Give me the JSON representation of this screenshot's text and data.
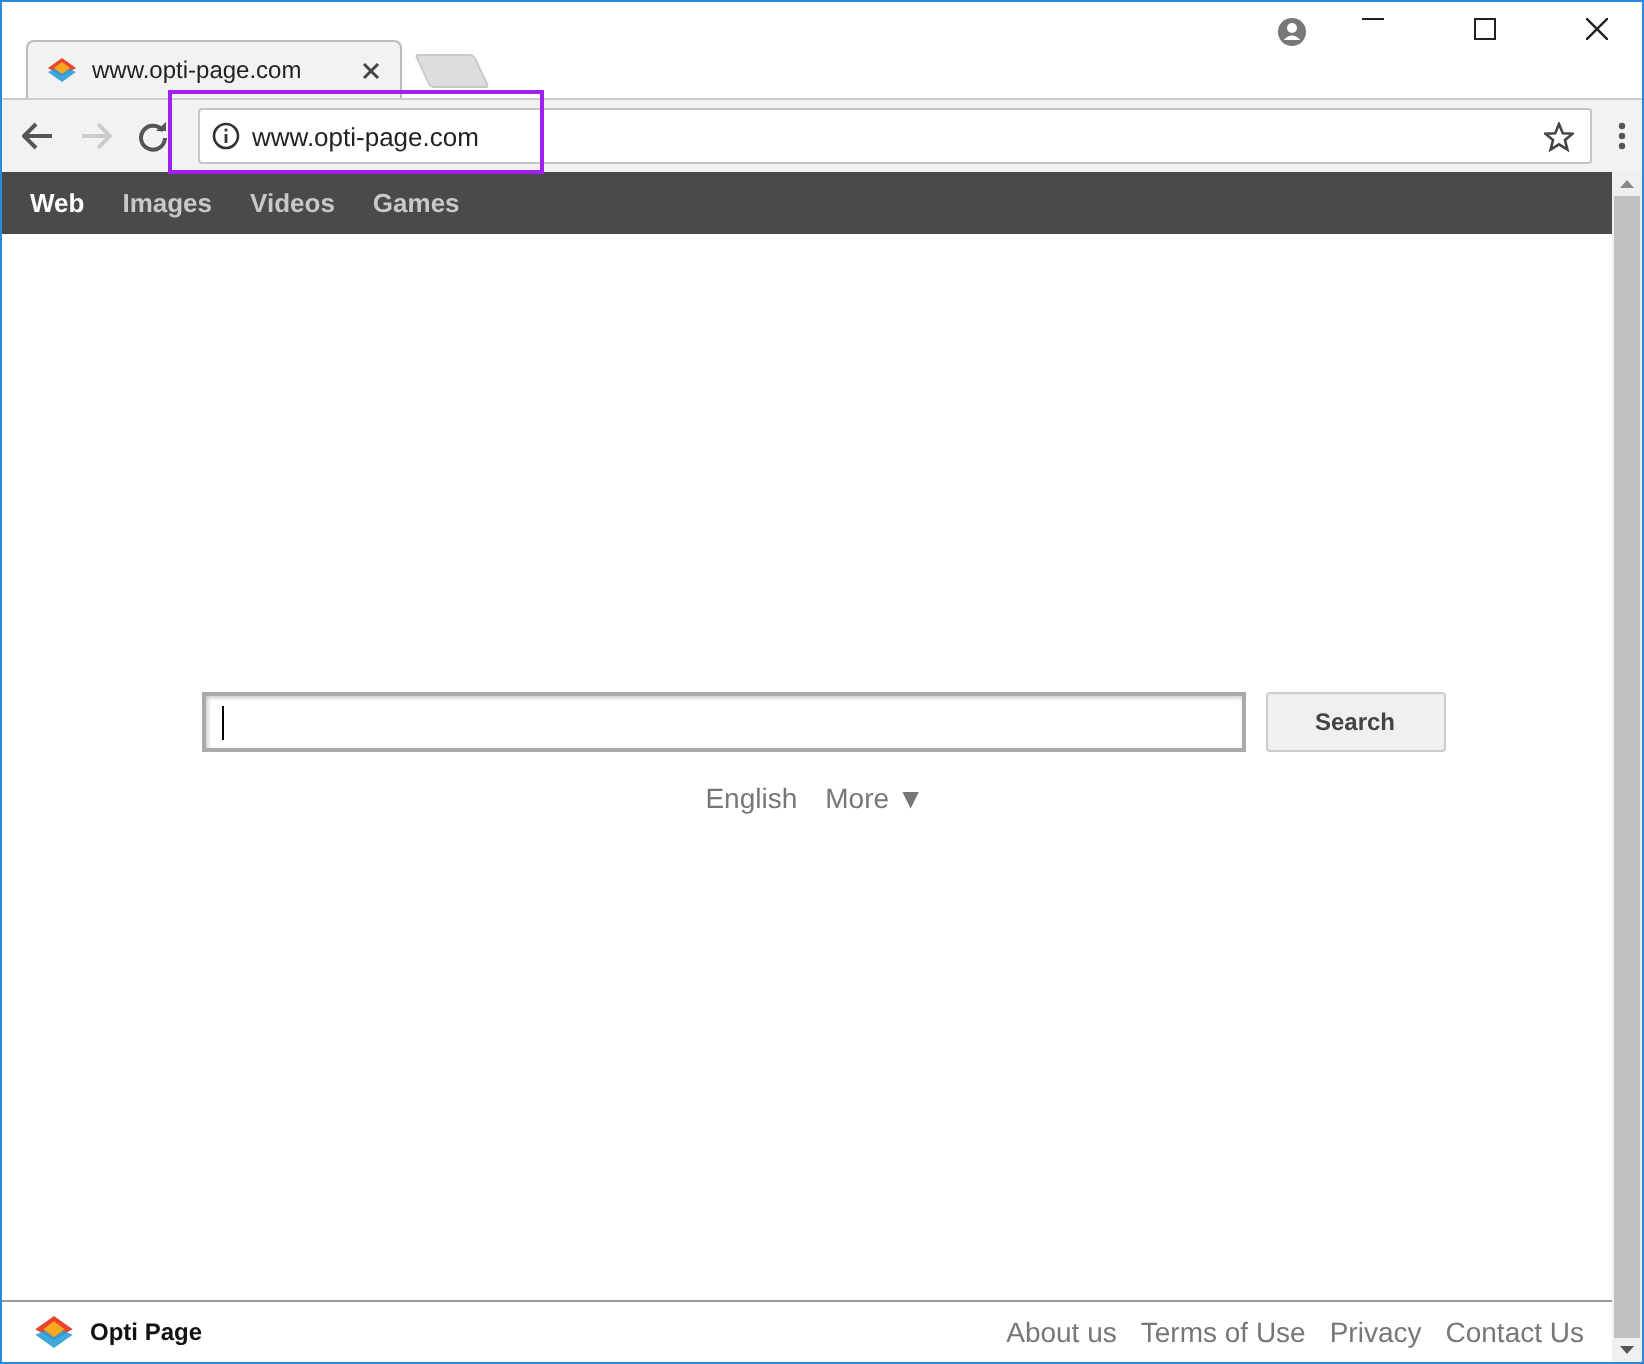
{
  "browser": {
    "tab_title": "www.opti-page.com",
    "address": "www.opti-page.com",
    "address_highlighted": true
  },
  "nav": [
    {
      "label": "Web",
      "selected": true
    },
    {
      "label": "Images",
      "selected": false
    },
    {
      "label": "Videos",
      "selected": false
    },
    {
      "label": "Games",
      "selected": false
    }
  ],
  "search": {
    "button": "Search"
  },
  "language_links": [
    "English",
    "More ▼"
  ],
  "footer": {
    "brand": "Opti Page",
    "links": [
      "About us",
      "Terms of Use",
      "Privacy",
      "Contact Us"
    ]
  }
}
